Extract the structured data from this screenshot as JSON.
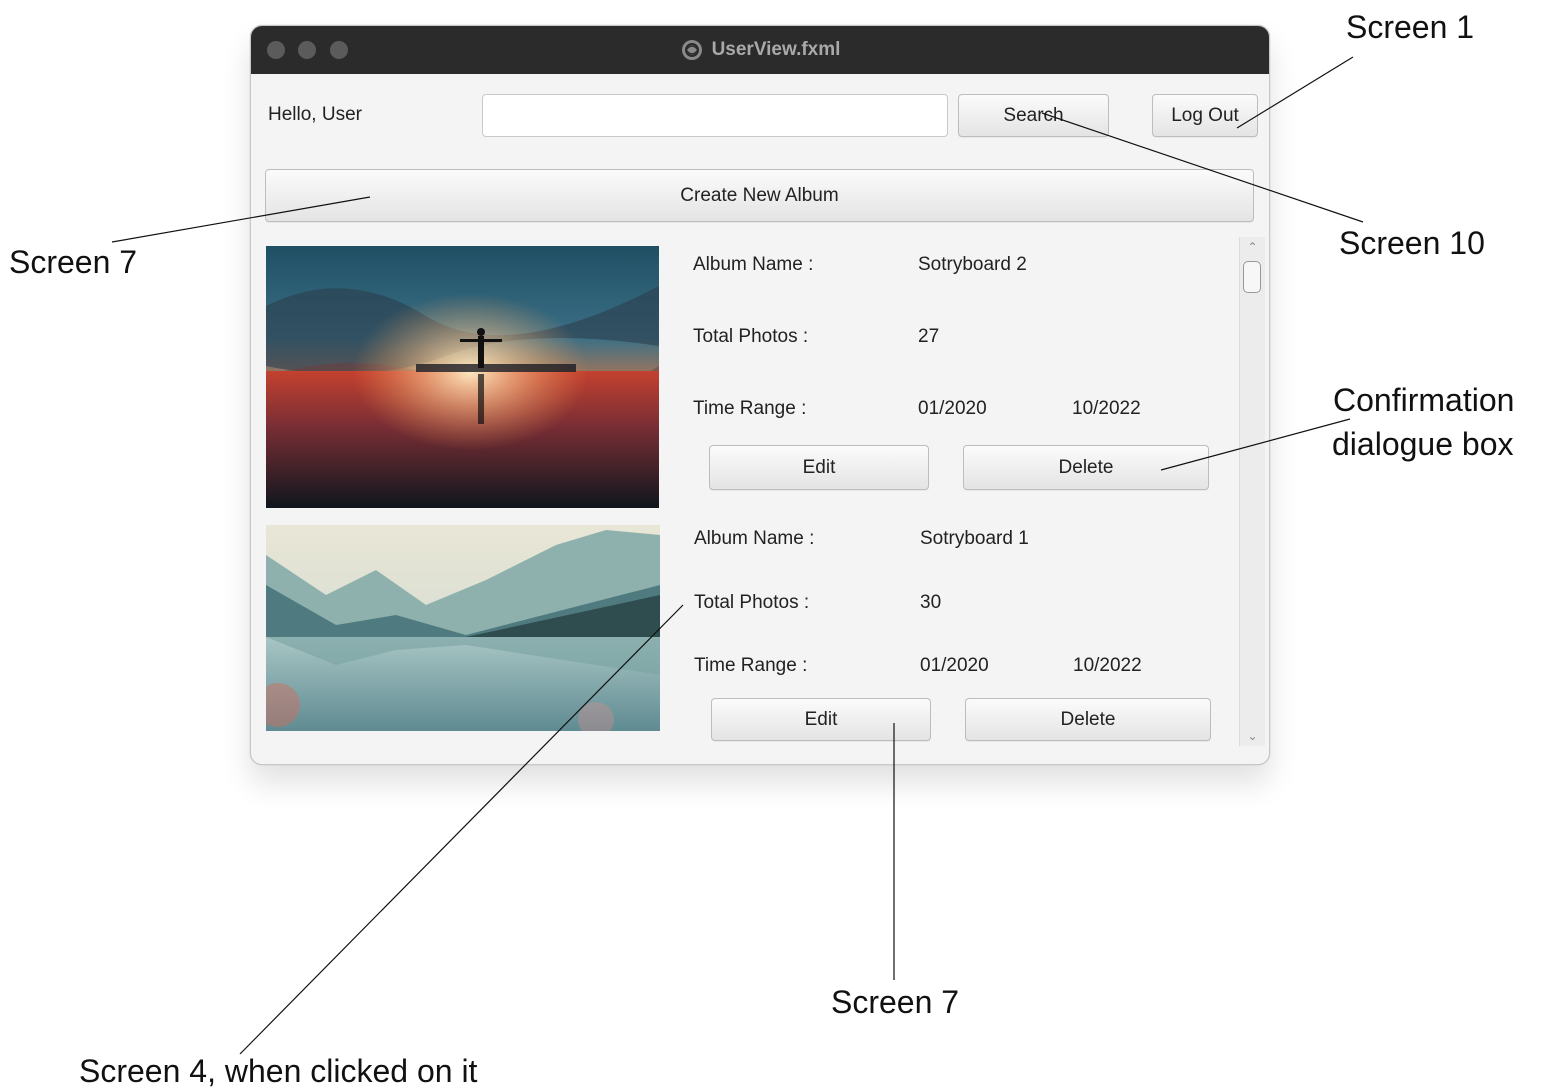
{
  "window": {
    "title": "UserView.fxml",
    "greeting": "Hello, User",
    "search": {
      "value": "",
      "placeholder": ""
    },
    "buttons": {
      "search": "Search",
      "logout": "Log Out",
      "create_album": "Create New Album"
    },
    "albums": [
      {
        "name_label": "Album Name :",
        "name": "Sotryboard 2",
        "photos_label": "Total Photos :",
        "photos": "27",
        "range_label": "Time Range :",
        "range_start": "01/2020",
        "range_end": "10/2022",
        "edit": "Edit",
        "delete": "Delete",
        "image_icon": "sunset-reflection-image"
      },
      {
        "name_label": "Album Name :",
        "name": "Sotryboard 1",
        "photos_label": "Total Photos :",
        "photos": "30",
        "range_label": "Time Range :",
        "range_start": "01/2020",
        "range_end": "10/2022",
        "edit": "Edit",
        "delete": "Delete",
        "image_icon": "mountain-lake-image"
      }
    ],
    "scrollbar": {
      "up_icon": "chevron-up-icon",
      "down_icon": "chevron-down-icon"
    }
  },
  "annotations": {
    "screen1": "Screen 1",
    "screen10": "Screen 10",
    "screen7_left": "Screen 7",
    "confirmation_line1": "Confirmation",
    "confirmation_line2": "dialogue box",
    "screen7_bottom": "Screen 7",
    "screen4": "Screen 4, when clicked on it"
  },
  "colors": {
    "titlebar": "#2b2b2b",
    "window_bg": "#f4f4f4"
  }
}
